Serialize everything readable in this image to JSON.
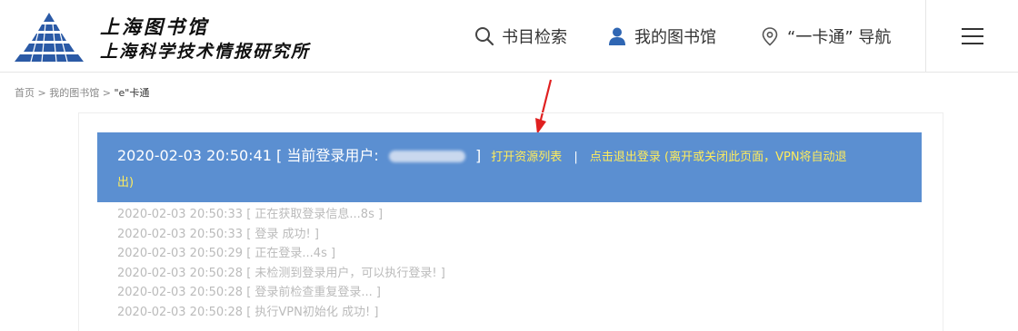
{
  "header": {
    "logo_line1": "上海图书馆",
    "logo_line2": "上海科学技术情报研究所",
    "nav": {
      "search": "书目检索",
      "my_library": "我的图书馆",
      "one_card": "“一卡通” 导航"
    }
  },
  "breadcrumb": {
    "home": "首页",
    "sep": ">",
    "my_library": "我的图书馆",
    "current": "\"e\"卡通"
  },
  "status_bar": {
    "timestamp": "2020-02-03 20:50:41",
    "user_prefix": "[ 当前登录用户:",
    "user_suffix": "]",
    "open_resources": "打开资源列表",
    "separator": "|",
    "logout_part1": "点击退出登录 (离开或关闭此页面，VPN将自动退",
    "logout_part2": "出)"
  },
  "log": [
    "2020-02-03 20:50:33  [ 正在获取登录信息...8s ]",
    "2020-02-03 20:50:33  [ 登录 成功! ]",
    "2020-02-03 20:50:29  [ 正在登录...4s ]",
    "2020-02-03 20:50:28  [ 未检测到登录用户，可以执行登录! ]",
    "2020-02-03 20:50:28  [ 登录前检查重复登录... ]",
    "2020-02-03 20:50:28  [ 执行VPN初始化 成功! ]"
  ],
  "colors": {
    "bar_bg": "#5b8fd1",
    "link_yellow": "#ffec5c",
    "arrow_red": "#e02020",
    "log_grey": "#bbbbbb"
  },
  "icons": [
    "logo-pyramid-icon",
    "search-icon",
    "user-icon",
    "location-pin-icon",
    "hamburger-menu-icon",
    "red-arrow-annotation"
  ]
}
